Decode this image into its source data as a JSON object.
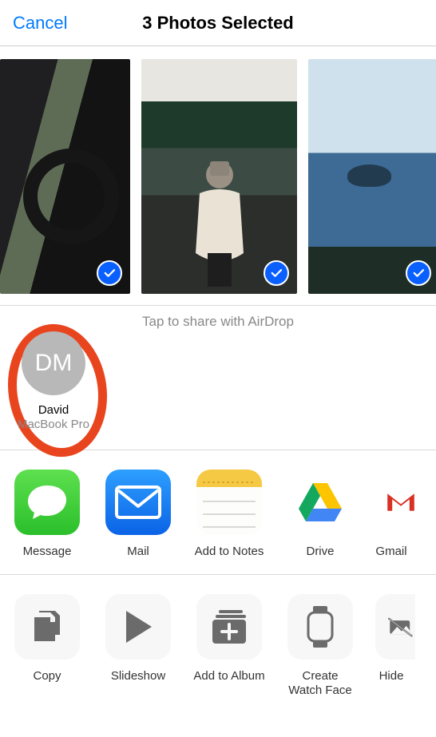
{
  "header": {
    "cancel": "Cancel",
    "title": "3 Photos Selected"
  },
  "airdrop": {
    "hint": "Tap to share with AirDrop",
    "targets": [
      {
        "initials": "DM",
        "name": "David",
        "device": "MacBook Pro"
      }
    ]
  },
  "apps": [
    {
      "id": "message",
      "label": "Message"
    },
    {
      "id": "mail",
      "label": "Mail"
    },
    {
      "id": "notes",
      "label": "Add to Notes"
    },
    {
      "id": "drive",
      "label": "Drive"
    },
    {
      "id": "gmail",
      "label": "Gmail"
    }
  ],
  "actions": [
    {
      "id": "copy",
      "label": "Copy"
    },
    {
      "id": "slideshow",
      "label": "Slideshow"
    },
    {
      "id": "add-to-album",
      "label": "Add to Album"
    },
    {
      "id": "watch-face",
      "label": "Create\nWatch Face"
    },
    {
      "id": "hide",
      "label": "Hide"
    }
  ],
  "photos": [
    {
      "id": "car-interior",
      "selected": true
    },
    {
      "id": "person-by-lake",
      "selected": true
    },
    {
      "id": "crater-lake",
      "selected": true
    }
  ]
}
